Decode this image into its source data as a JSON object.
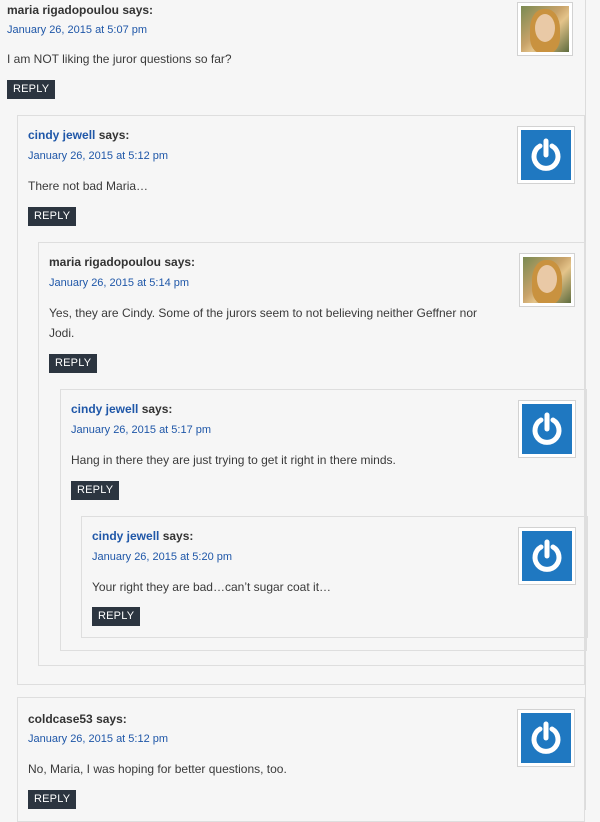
{
  "comments": [
    {
      "author": "maria rigadopoulou",
      "author_is_link": false,
      "says": "says:",
      "date": "January 26, 2015 at 5:07 pm",
      "text": "I am NOT liking the juror questions so far?",
      "reply": "REPLY",
      "avatar": "photo-avatar"
    },
    {
      "author": "cindy jewell",
      "author_is_link": true,
      "says": "says:",
      "date": "January 26, 2015 at 5:12 pm",
      "text": "There not bad Maria…",
      "reply": "REPLY",
      "avatar": "power-icon"
    },
    {
      "author": "maria rigadopoulou",
      "author_is_link": false,
      "says": "says:",
      "date": "January 26, 2015 at 5:14 pm",
      "text": "Yes, they are Cindy. Some of the jurors seem to not believing neither Geffner nor Jodi.",
      "reply": "REPLY",
      "avatar": "photo-avatar"
    },
    {
      "author": "cindy jewell",
      "author_is_link": true,
      "says": "says:",
      "date": "January 26, 2015 at 5:17 pm",
      "text": "Hang in there they are just trying to get it right in there minds.",
      "reply": "REPLY",
      "avatar": "power-icon"
    },
    {
      "author": "cindy jewell",
      "author_is_link": true,
      "says": "says:",
      "date": "January 26, 2015 at 5:20 pm",
      "text": "Your right they are bad…can’t sugar coat it…",
      "reply": "REPLY",
      "avatar": "power-icon"
    },
    {
      "author": "coldcase53",
      "author_is_link": false,
      "says": "says:",
      "date": "January 26, 2015 at 5:12 pm",
      "text": "No, Maria, I was hoping for better questions, too.",
      "reply": "REPLY",
      "avatar": "power-icon"
    }
  ],
  "colors": {
    "link": "#1f57a8",
    "reply_bg": "#2c3540",
    "icon_bg": "#1f78c1"
  }
}
